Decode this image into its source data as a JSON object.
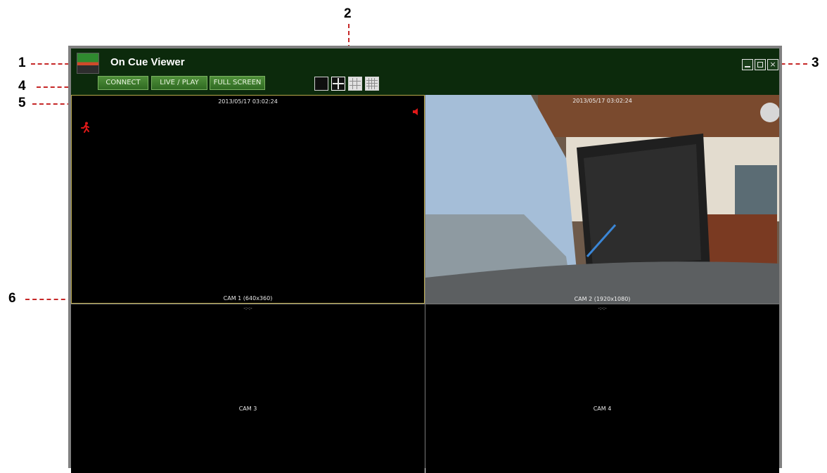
{
  "callouts": [
    "1",
    "2",
    "3",
    "4",
    "5",
    "6"
  ],
  "app": {
    "title": "On Cue Viewer",
    "buttons": {
      "connect": "CONNECT",
      "live_play": "LIVE / PLAY",
      "full_screen": "FULL SCREEN"
    },
    "layout_options": [
      "1x1",
      "2x2",
      "3x3",
      "4x4"
    ],
    "window_controls": [
      "minimize-icon",
      "restore-icon",
      "close-icon"
    ]
  },
  "tiles": [
    {
      "timestamp": "2013/05/17 03:02:24",
      "label": "CAM 1 (640x360)",
      "selected": true,
      "icons": [
        "motion-icon",
        "audio-icon"
      ]
    },
    {
      "timestamp": "2013/05/17 03:02:24",
      "label": "CAM 2 (1920x1080)",
      "selected": false
    },
    {
      "subtitle": "-:-:-",
      "label": "CAM 3"
    },
    {
      "subtitle": "-:-:-",
      "label": "CAM 4"
    }
  ],
  "colors": {
    "header_bg": "#0c2a0c",
    "button_green": "#3f7f30",
    "callout_line": "#c62828",
    "selection_border": "#b8a84a",
    "audio_red": "#e01818"
  }
}
